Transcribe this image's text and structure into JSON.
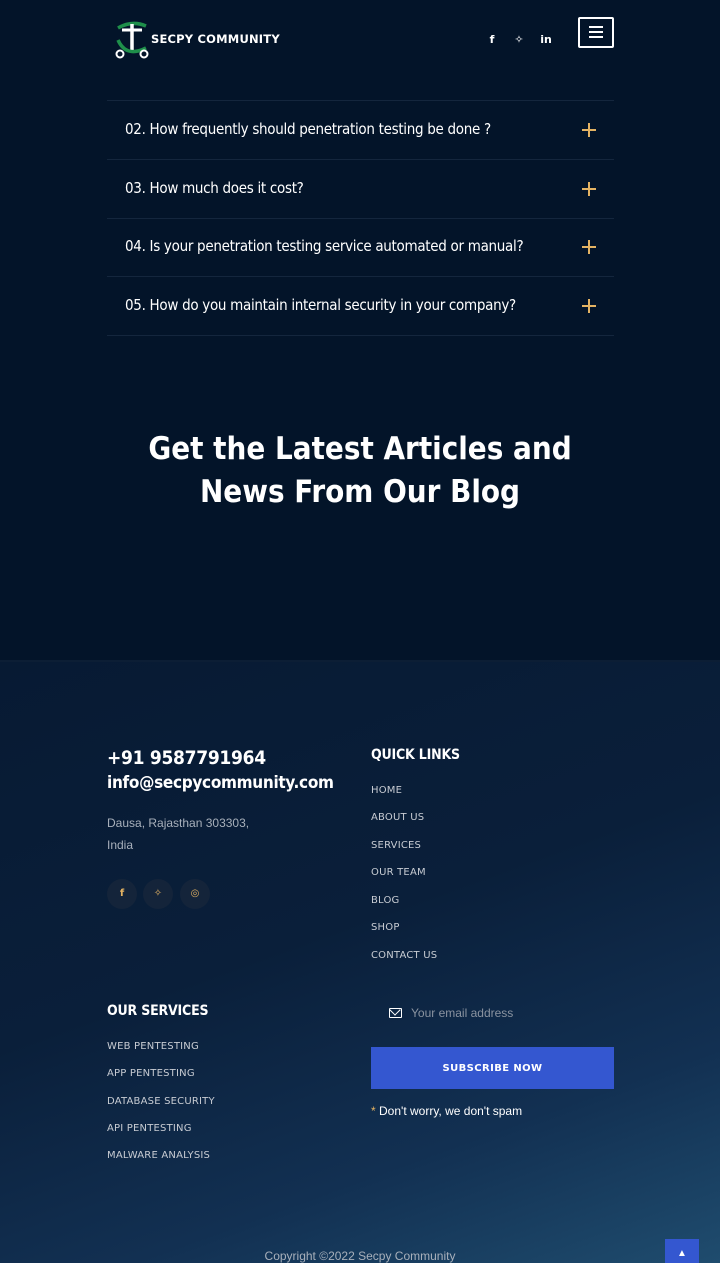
{
  "header": {
    "logo_text": "SECPY COMMUNITY",
    "social": [
      {
        "icon": "facebook-icon",
        "glyph": "f"
      },
      {
        "icon": "twitter-icon",
        "glyph": "✧"
      },
      {
        "icon": "linkedin-icon",
        "glyph": "in"
      }
    ]
  },
  "faq": {
    "items": [
      {
        "question": "02. How frequently should penetration testing be done ?"
      },
      {
        "question": "03. How much does it cost?"
      },
      {
        "question": "04. Is your penetration testing service automated or manual?"
      },
      {
        "question": "05. How do you maintain internal security in your company?"
      }
    ]
  },
  "blog": {
    "title_line1": "Get the Latest Articles and",
    "title_line2": "News From Our Blog"
  },
  "contact": {
    "phone": "+91 9587791964",
    "email": "info@secpycommunity.com",
    "address_line1": "Dausa, Rajasthan 303303,",
    "address_line2": "India",
    "social": [
      {
        "icon": "facebook-icon",
        "glyph": "f"
      },
      {
        "icon": "twitter-icon",
        "glyph": "✧"
      },
      {
        "icon": "instagram-icon",
        "glyph": "◎"
      }
    ]
  },
  "quick_links": {
    "heading": "QUICK LINKS",
    "items": [
      "HOME",
      "ABOUT US",
      "SERVICES",
      "OUR TEAM",
      "BLOG",
      "SHOP",
      "CONTACT US"
    ]
  },
  "services": {
    "heading": "OUR SERVICES",
    "items": [
      "WEB PENTESTING",
      "APP PENTESTING",
      "DATABASE SECURITY",
      "API PENTESTING",
      "MALWARE ANALYSIS"
    ]
  },
  "subscribe": {
    "placeholder": "Your email address",
    "button_label": "SUBSCRIBE NOW",
    "note_star": "*",
    "note_text": "Don't worry, we don't spam"
  },
  "footer": {
    "copyright": "Copyright ©2022 Secpy Community",
    "back_to_top_glyph": "▲"
  },
  "colors": {
    "background": "#031429",
    "accent_gold": "#e4b363",
    "button_blue": "#3457d0"
  }
}
